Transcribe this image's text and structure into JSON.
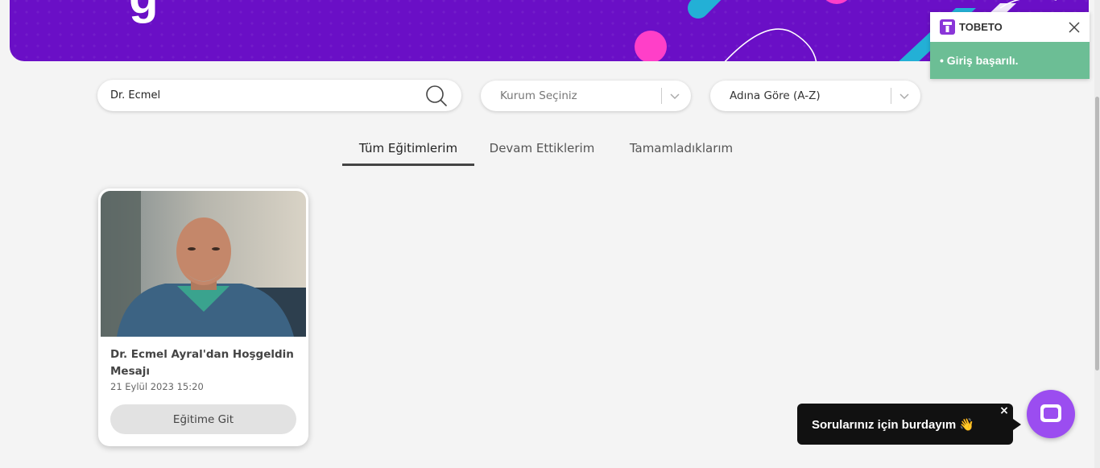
{
  "colors": {
    "banner": "#6a0fc6",
    "toast_success": "#6cbe95",
    "chat_launcher": "#9b4df0",
    "chat_bubble": "#111111"
  },
  "search": {
    "value": "Dr. Ecmel",
    "icon": "search-icon"
  },
  "filters": {
    "organization": {
      "value": "Kurum Seçiniz"
    },
    "sort": {
      "value": "Adına Göre (A-Z)"
    }
  },
  "tabs": [
    {
      "label": "Tüm Eğitimlerim",
      "active": true
    },
    {
      "label": "Devam Ettiklerim",
      "active": false
    },
    {
      "label": "Tamamladıklarım",
      "active": false
    }
  ],
  "courses": [
    {
      "title": "Dr. Ecmel Ayral'dan Hoşgeldin Mesajı",
      "date": "21 Eylül 2023 15:20",
      "button_label": "Eğitime Git"
    }
  ],
  "toast": {
    "brand": "TOBETO",
    "message": "• Giriş başarılı."
  },
  "chat": {
    "bubble_text": "Sorularınız için burdayım 👋",
    "close_glyph": "×"
  }
}
